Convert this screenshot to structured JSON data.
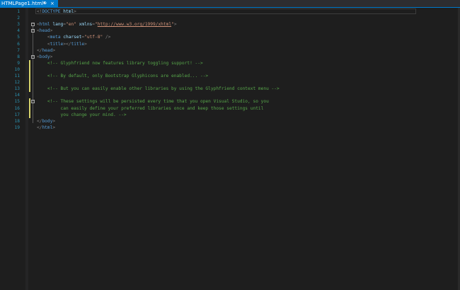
{
  "tab": {
    "title": "HTMLPage1.html*",
    "pin_glyph": "⊕",
    "close_glyph": "×"
  },
  "colors": {
    "background": "#1e1e1e",
    "tab_active": "#007acc",
    "line_number": "#2b91af",
    "tag": "#569cd6",
    "attribute": "#9cdcfe",
    "string": "#ce9178",
    "comment": "#57a64a",
    "change_marker": "#d7d36b"
  },
  "editor": {
    "lines": [
      {
        "n": "1",
        "tokens": [
          [
            "br",
            "<!"
          ],
          [
            "tag",
            "DOCTYPE"
          ],
          [
            "plain",
            " "
          ],
          [
            "attr",
            "html"
          ],
          [
            "br",
            ">"
          ]
        ]
      },
      {
        "n": "2",
        "tokens": []
      },
      {
        "n": "3",
        "tokens": [
          [
            "br",
            "<"
          ],
          [
            "tag",
            "html"
          ],
          [
            "plain",
            " "
          ],
          [
            "attr",
            "lang"
          ],
          [
            "br",
            "="
          ],
          [
            "str",
            "\"en\""
          ],
          [
            "plain",
            " "
          ],
          [
            "attr",
            "xmlns"
          ],
          [
            "br",
            "="
          ],
          [
            "str",
            "\""
          ],
          [
            "url",
            "http://www.w3.org/1999/xhtml"
          ],
          [
            "str",
            "\""
          ],
          [
            "br",
            ">"
          ]
        ]
      },
      {
        "n": "4",
        "tokens": [
          [
            "br",
            "<"
          ],
          [
            "tag",
            "head"
          ],
          [
            "br",
            ">"
          ]
        ]
      },
      {
        "n": "5",
        "tokens": [
          [
            "plain",
            "    "
          ],
          [
            "br",
            "<"
          ],
          [
            "tag",
            "meta"
          ],
          [
            "plain",
            " "
          ],
          [
            "attr",
            "charset"
          ],
          [
            "br",
            "="
          ],
          [
            "str",
            "\"utf-8\""
          ],
          [
            "plain",
            " "
          ],
          [
            "br",
            "/>"
          ]
        ]
      },
      {
        "n": "6",
        "tokens": [
          [
            "plain",
            "    "
          ],
          [
            "br",
            "<"
          ],
          [
            "tag",
            "title"
          ],
          [
            "br",
            "></"
          ],
          [
            "tag",
            "title"
          ],
          [
            "br",
            ">"
          ]
        ]
      },
      {
        "n": "7",
        "tokens": [
          [
            "br",
            "</"
          ],
          [
            "tag",
            "head"
          ],
          [
            "br",
            ">"
          ]
        ]
      },
      {
        "n": "8",
        "tokens": [
          [
            "br",
            "<"
          ],
          [
            "tag",
            "body"
          ],
          [
            "br",
            ">"
          ]
        ]
      },
      {
        "n": "9",
        "tokens": [
          [
            "plain",
            "    "
          ],
          [
            "cmt",
            "<!-- Glyphfriend now features library toggling support! -->"
          ]
        ]
      },
      {
        "n": "10",
        "tokens": []
      },
      {
        "n": "11",
        "tokens": [
          [
            "plain",
            "    "
          ],
          [
            "cmt",
            "<!-- By default, only Bootstrap Glyphicons are enabled... -->"
          ]
        ]
      },
      {
        "n": "12",
        "tokens": []
      },
      {
        "n": "13",
        "tokens": [
          [
            "plain",
            "    "
          ],
          [
            "cmt",
            "<!-- But you can easily enable other libraries by using the Glyphfriend context menu -->"
          ]
        ]
      },
      {
        "n": "14",
        "tokens": []
      },
      {
        "n": "15",
        "tokens": [
          [
            "plain",
            "    "
          ],
          [
            "cmt",
            "<!-- These settings will be persisted every time that you open Visual Studio, so you"
          ]
        ]
      },
      {
        "n": "16",
        "tokens": [
          [
            "plain",
            "    "
          ],
          [
            "cmt",
            "     can easily define your preferred libraries once and keep those settings until"
          ]
        ]
      },
      {
        "n": "17",
        "tokens": [
          [
            "plain",
            "    "
          ],
          [
            "cmt",
            "     you change your mind. -->"
          ]
        ]
      },
      {
        "n": "18",
        "tokens": [
          [
            "br",
            "</"
          ],
          [
            "tag",
            "body"
          ],
          [
            "br",
            ">"
          ]
        ]
      },
      {
        "n": "19",
        "tokens": [
          [
            "br",
            "</"
          ],
          [
            "tag",
            "html"
          ],
          [
            "br",
            ">"
          ]
        ]
      }
    ]
  }
}
